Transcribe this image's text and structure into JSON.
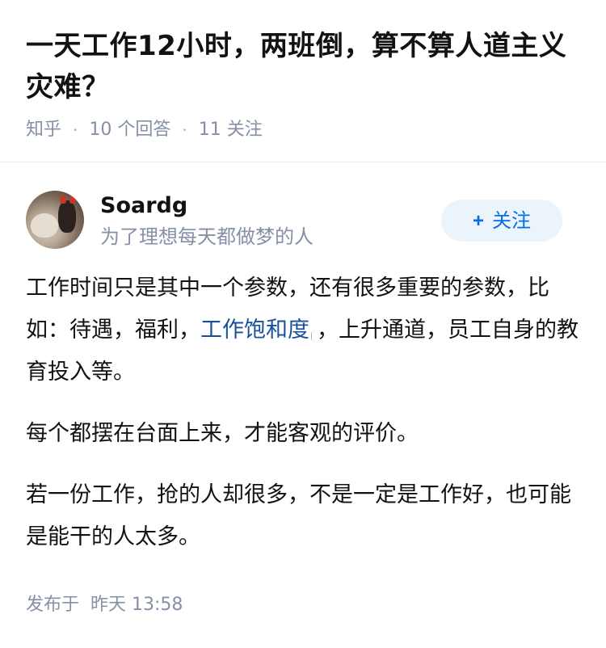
{
  "question": {
    "title": "一天工作12小时，两班倒，算不算人道主义灾难？",
    "source": "知乎",
    "answer_count": "10 个回答",
    "follower_count": "11 关注"
  },
  "author": {
    "name": "Soardg",
    "bio": "为了理想每天都做梦的人",
    "follow_label": "关注",
    "follow_icon": "+"
  },
  "answer": {
    "p1_before": "工作时间只是其中一个参数，还有很多重要的参数，比如：待遇，福利，",
    "p1_link": "工作饱和度",
    "p1_after": "，上升通道，员工自身的教育投入等。",
    "p2": "每个都摆在台面上来，才能客观的评价。",
    "p3": "若一份工作，抢的人却很多，不是一定是工作好，也可能是能干的人太多。"
  },
  "footer": {
    "published_label": "发布于",
    "published_time": "昨天 13:58"
  },
  "colors": {
    "accent": "#056de8",
    "link": "#175199",
    "meta_gray": "#8590a6",
    "follow_bg": "#ebf3fb"
  }
}
